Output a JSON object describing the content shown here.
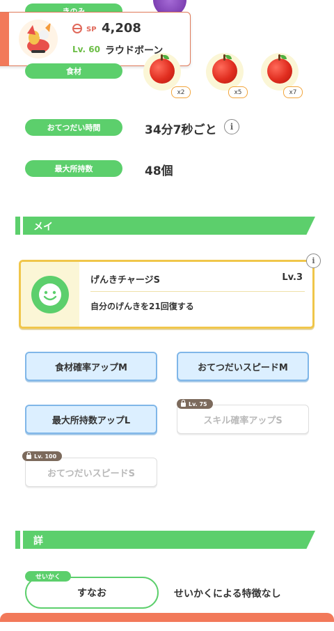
{
  "pokemon_card": {
    "sp_label": "SP",
    "sp_value": "4,208",
    "level": "Lv. 60",
    "name": "ラウドボーン"
  },
  "rows": {
    "berry_label": "きのみ",
    "ingredients_label": "食材",
    "ingredients": [
      {
        "item": "apple",
        "qty": "x2"
      },
      {
        "item": "apple",
        "qty": "x5"
      },
      {
        "item": "apple",
        "qty": "x7"
      }
    ],
    "help_time_label": "おてつだい時間",
    "help_time_value": "34分7秒ごと",
    "max_carry_label": "最大所持数",
    "max_carry_value": "48個"
  },
  "skills_section": {
    "title": "メインスキル・サブスキル",
    "main_skill": {
      "name": "げんきチャージS",
      "level": "Lv.3",
      "description": "自分のげんきを21回復する",
      "icon": "smile-icon"
    },
    "sub_skills": [
      {
        "label": "食材確率アップM",
        "locked": false
      },
      {
        "label": "おてつだいスピードM",
        "locked": false
      },
      {
        "label": "最大所持数アップL",
        "locked": false
      },
      {
        "label": "スキル確率アップS",
        "locked": true,
        "unlock": "Lv. 75"
      },
      {
        "label": "おてつだいスピードS",
        "locked": true,
        "unlock": "Lv. 100"
      }
    ]
  },
  "status_section": {
    "title": "詳細ステータス",
    "nature_tag": "せいかく",
    "nature_value": "すなお",
    "nature_effect": "せいかくによる特徴なし"
  },
  "colors": {
    "accent_green": "#5ccf6c",
    "sub_skill_blue": "#dcefff",
    "card_border": "#f0c64a",
    "footer_orange": "#f2795a"
  }
}
